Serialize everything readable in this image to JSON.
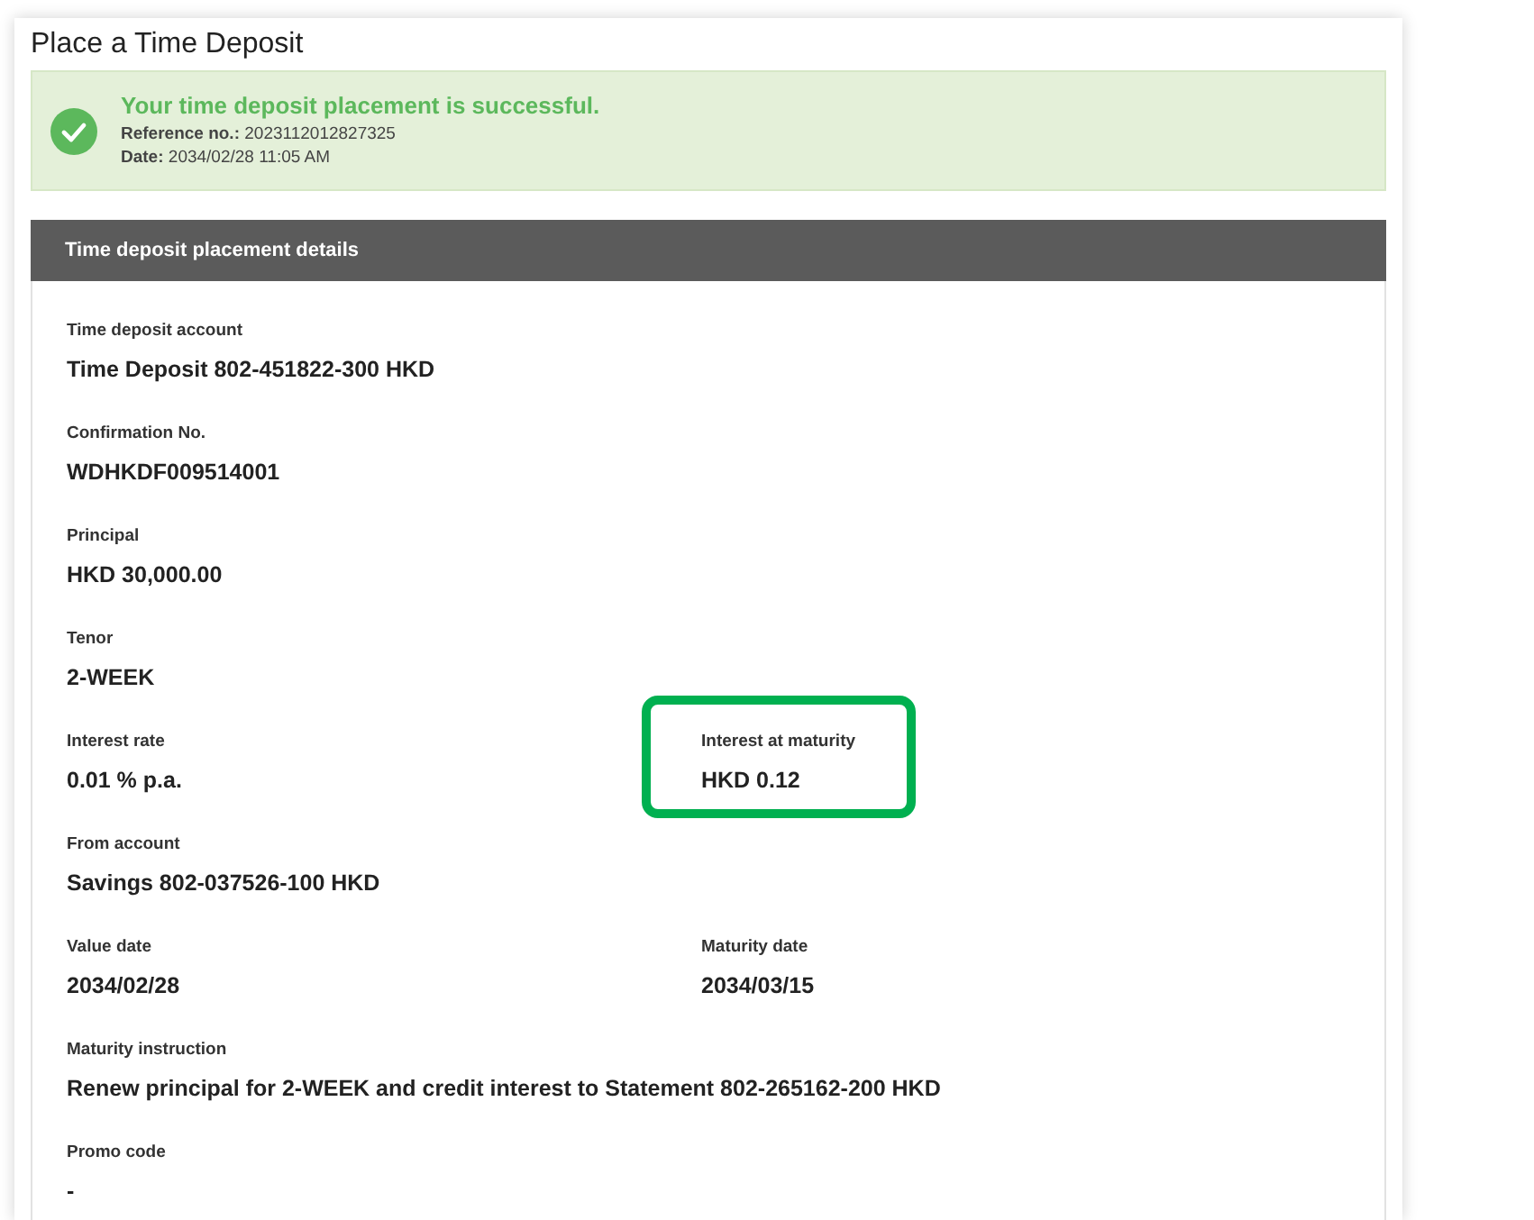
{
  "page_title": "Place a Time Deposit",
  "success": {
    "message": "Your time deposit placement is successful.",
    "reference_label": "Reference no.:",
    "reference": "2023112012827325",
    "date_label": "Date:",
    "date": "2034/02/28 11:05 AM"
  },
  "details": {
    "header": "Time deposit placement details",
    "rows": [
      [
        {
          "label": "Time deposit account",
          "value": "Time Deposit 802-451822-300 HKD",
          "highlighted": false
        }
      ],
      [
        {
          "label": "Confirmation No.",
          "value": "WDHKDF009514001",
          "highlighted": false
        }
      ],
      [
        {
          "label": "Principal",
          "value": "HKD 30,000.00",
          "highlighted": false
        }
      ],
      [
        {
          "label": "Tenor",
          "value": "2-WEEK",
          "highlighted": false
        }
      ],
      [
        {
          "label": "Interest rate",
          "value": "0.01 % p.a.",
          "highlighted": false
        },
        {
          "label": "Interest at maturity",
          "value": "HKD 0.12",
          "highlighted": true
        }
      ],
      [
        {
          "label": "From account",
          "value": "Savings 802-037526-100 HKD",
          "highlighted": false
        }
      ],
      [
        {
          "label": "Value date",
          "value": "2034/02/28",
          "highlighted": false
        },
        {
          "label": "Maturity date",
          "value": "2034/03/15",
          "highlighted": false
        }
      ],
      [
        {
          "label": "Maturity instruction",
          "value": "Renew principal for 2-WEEK and credit interest to Statement 802-265162-200 HKD",
          "highlighted": false
        }
      ],
      [
        {
          "label": "Promo code",
          "value": "-",
          "highlighted": false
        }
      ]
    ]
  }
}
